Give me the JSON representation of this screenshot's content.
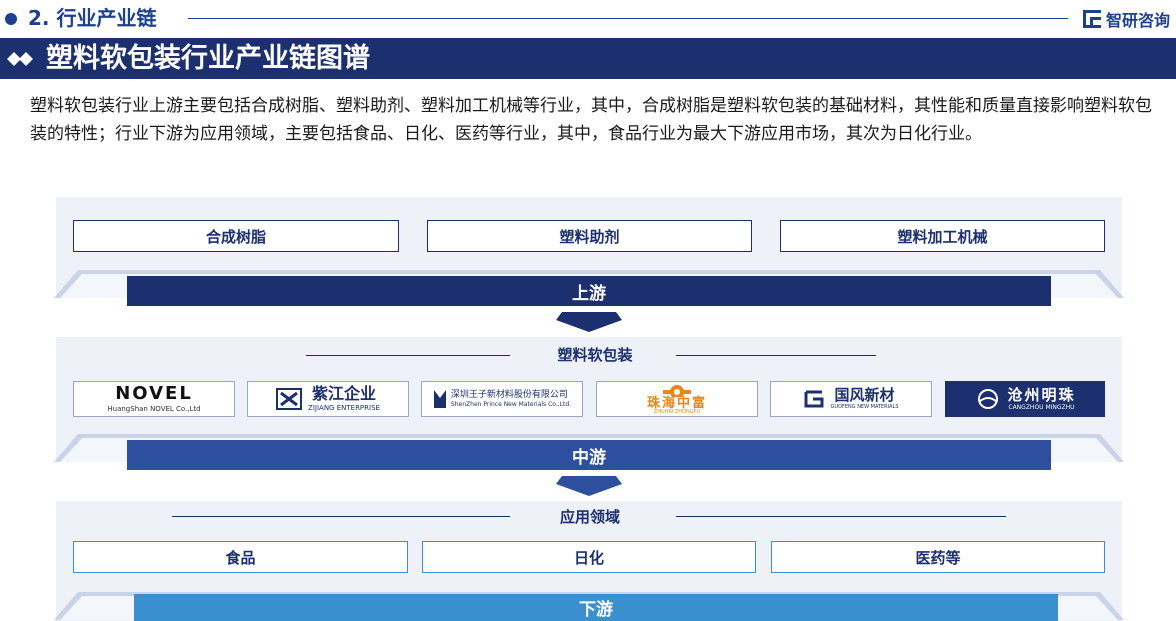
{
  "section": {
    "title": "2. 行业产业链"
  },
  "brand": {
    "name": "智研咨询"
  },
  "banner": {
    "title": "塑料软包装行业产业链图谱"
  },
  "description": "塑料软包装行业上游主要包括合成树脂、塑料助剂、塑料加工机械等行业，其中，合成树脂是塑料软包装的基础材料，其性能和质量直接影响塑料软包装的特性；行业下游为应用领域，主要包括食品、日化、医药等行业，其中，食品行业为最大下游应用市场，其次为日化行业。",
  "colors": {
    "navy": "#1c2f6e",
    "band": "#eef1f7",
    "upstream": "#1c2f6e",
    "midstream": "#2d4f9e",
    "downstream": "#3a8fcf"
  },
  "upstream": {
    "items": [
      "合成树脂",
      "塑料助剂",
      "塑料加工机械"
    ],
    "label": "上游"
  },
  "midstream": {
    "heading": "塑料软包装",
    "label": "中游",
    "logos": [
      {
        "main": "NOVEL",
        "sub": "HuangShan NOVEL Co.,Ltd"
      },
      {
        "main": "紫江企业",
        "sub": "ZIJIANG ENTERPRISE"
      },
      {
        "main": "深圳王子新材料股份有限公司",
        "sub": "ShenZhen Prince New Materials Co.,Ltd."
      },
      {
        "main": "珠海中富",
        "sub": "ZHUHAI ZHONGFU"
      },
      {
        "main": "国风新材",
        "sub": "GUOFENG NEW MATERIALS"
      },
      {
        "main": "沧州明珠",
        "sub": "CANGZHOU MINGZHU"
      }
    ]
  },
  "downstream": {
    "heading": "应用领域",
    "label": "下游",
    "items": [
      "食品",
      "日化",
      "医药等"
    ]
  }
}
